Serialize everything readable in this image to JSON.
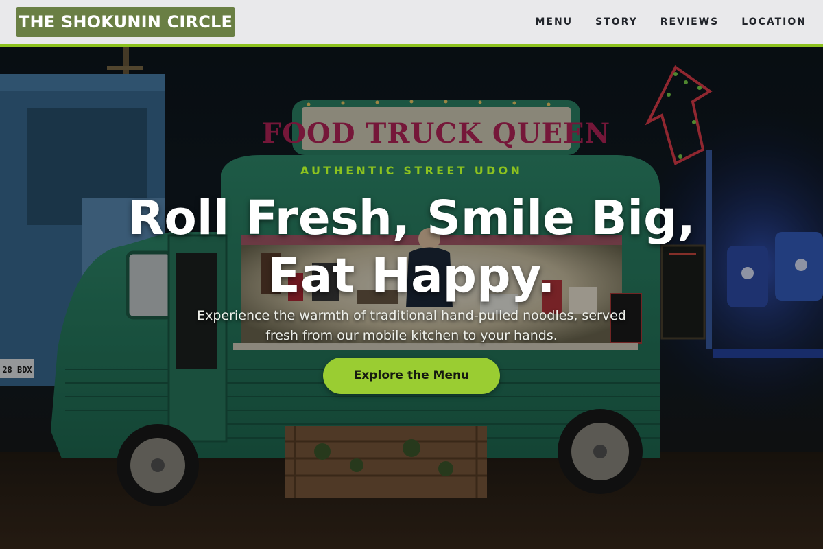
{
  "header": {
    "logo_text": "THE SHOKUNIN CIRCLE",
    "nav": [
      {
        "label": "MENU"
      },
      {
        "label": "STORY"
      },
      {
        "label": "REVIEWS"
      },
      {
        "label": "LOCATION"
      }
    ]
  },
  "hero": {
    "eyebrow": "AUTHENTIC STREET UDON",
    "headline_line1": "Roll Fresh, Smile Big,",
    "headline_line2": "Eat Happy.",
    "subtitle_line1": "Experience the warmth of traditional hand-pulled noodles, served",
    "subtitle_line2": "fresh from our mobile kitchen to your hands.",
    "cta_label": "Explore the Menu",
    "truck_sign": "FOOD TRUCK QUEEN",
    "van_plate": "28 BDX"
  },
  "colors": {
    "header_bg": "#e9e9eb",
    "accent_green": "#8dc21f",
    "logo_bg": "#6a7f44",
    "cta_bg": "#9acd32",
    "truck_teal": "#2a8064"
  }
}
